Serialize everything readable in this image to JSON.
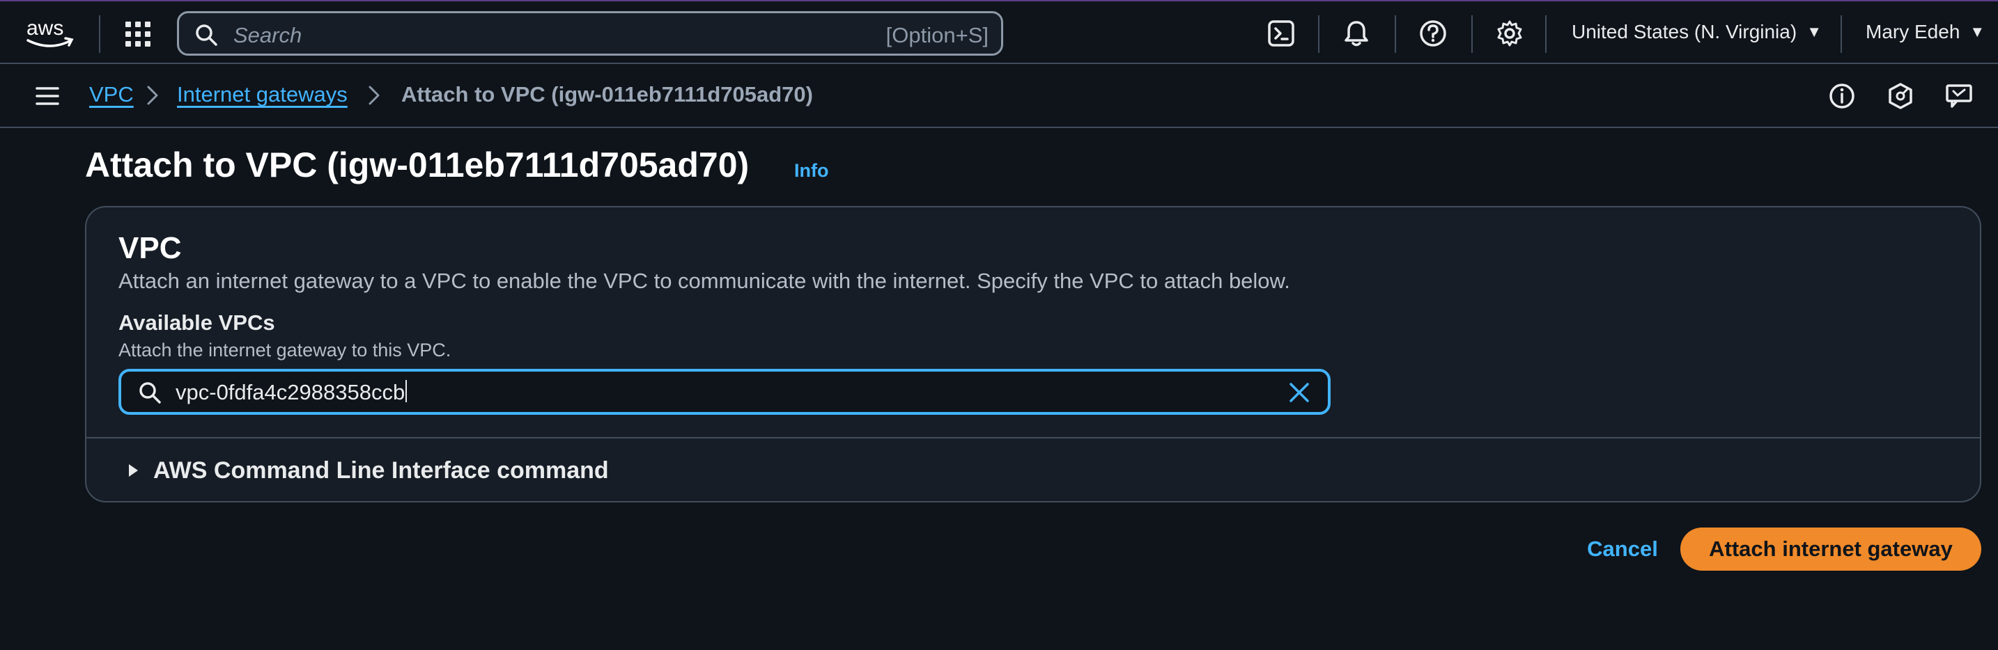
{
  "topnav": {
    "logo_text": "aws",
    "search_placeholder": "Search",
    "search_shortcut": "[Option+S]",
    "icons": [
      "cloudshell-icon",
      "bell-icon",
      "help-icon",
      "gear-icon"
    ],
    "region": "United States (N. Virginia)",
    "user": "Mary Edeh"
  },
  "breadcrumb": {
    "items": [
      {
        "label": "VPC",
        "link": true
      },
      {
        "label": "Internet gateways",
        "link": true
      },
      {
        "label": "Attach to VPC (igw-011eb7111d705ad70)",
        "link": false
      }
    ],
    "right_icons": [
      "info-circle-icon",
      "compass-icon",
      "feedback-icon"
    ]
  },
  "page": {
    "title": "Attach to VPC (igw-011eb7111d705ad70)",
    "info": "Info"
  },
  "panel": {
    "title": "VPC",
    "description": "Attach an internet gateway to a VPC to enable the VPC to communicate with the internet. Specify the VPC to attach below.",
    "field_label": "Available VPCs",
    "field_description": "Attach the internet gateway to this VPC.",
    "field_value": "vpc-0fdfa4c2988358ccb",
    "expander_label": "AWS Command Line Interface command"
  },
  "actions": {
    "cancel": "Cancel",
    "submit": "Attach internet gateway"
  },
  "colors": {
    "background": "#0f141a",
    "link": "#42b4ff",
    "primary": "#f08a2a",
    "border": "#414d5c"
  }
}
